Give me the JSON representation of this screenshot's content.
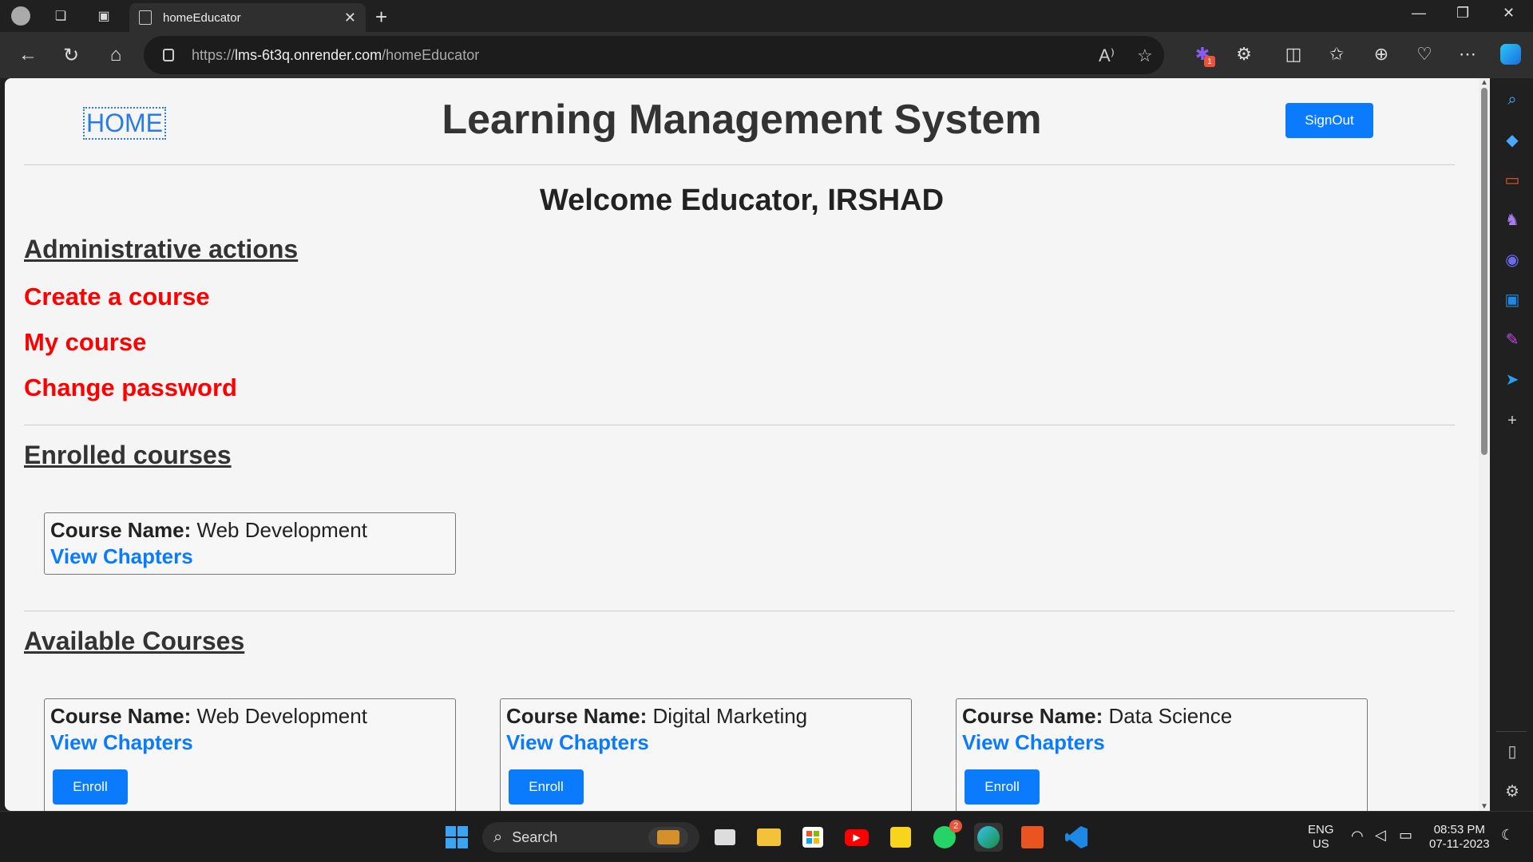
{
  "browser": {
    "tab_title": "homeEducator",
    "url_prefix": "https://",
    "url_host": "lms-6t3q.onrender.com",
    "url_path": "/homeEducator",
    "new_tab": "+",
    "tab_close": "✕",
    "win_min": "—",
    "win_restore": "❐",
    "win_close": "✕",
    "nav_back": "←",
    "nav_refresh": "↻",
    "nav_home": "⌂",
    "read_aloud": "A⁾",
    "favorite": "☆",
    "ext_badge": "1",
    "ext_icons": [
      "✱",
      "⚙",
      "◫",
      "✩",
      "⊕",
      "♡",
      "⋯"
    ]
  },
  "sidebar": {
    "icons": [
      "⌕",
      "◆",
      "▭",
      "♞",
      "◉",
      "▣",
      "✎",
      "➤",
      "+",
      "▯",
      "⚙"
    ]
  },
  "page": {
    "home_link": "HOME",
    "site_title": "Learning Management System",
    "signout": "SignOut",
    "welcome": "Welcome Educator, IRSHAD",
    "admin_heading": "Administrative actions",
    "actions": [
      "Create a course",
      "My course",
      "Change password"
    ],
    "enrolled_heading": "Enrolled courses",
    "course_name_label": "Course Name:",
    "view_chapters": "View Chapters",
    "enroll": "Enroll",
    "enrolled_courses": [
      "Web Development"
    ],
    "available_heading": "Available Courses",
    "available_courses": [
      "Web Development",
      "Digital Marketing",
      "Data Science"
    ]
  },
  "taskbar": {
    "search_placeholder": "Search",
    "whatsapp_badge": "2",
    "lang": "ENG",
    "region": "US",
    "time": "08:53 PM",
    "date": "07-11-2023"
  },
  "colors": {
    "accent": "#0b7bfe",
    "action_red": "#ff0000",
    "link_blue": "#2a7be4"
  }
}
